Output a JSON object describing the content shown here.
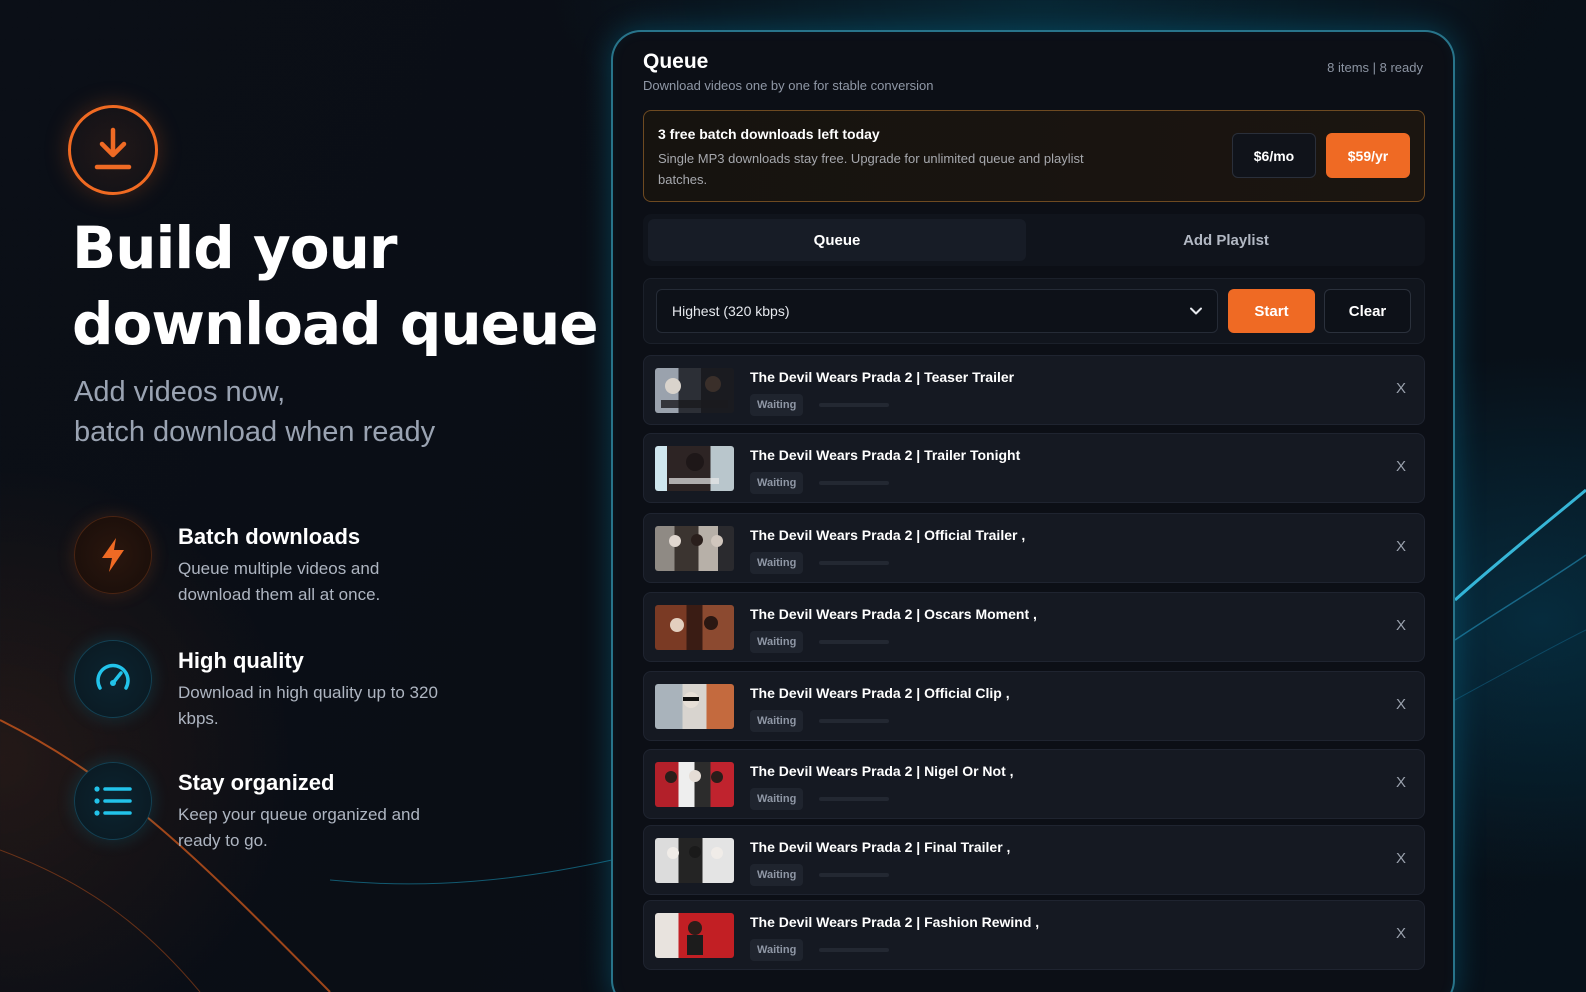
{
  "hero": {
    "title_line1": "Build your",
    "title_line2": "download queue",
    "subtitle_line1": "Add videos now,",
    "subtitle_line2": "batch download when ready",
    "icon": "download-icon",
    "accent": "#ef6a24"
  },
  "features": [
    {
      "icon": "lightning-icon",
      "title": "Batch downloads",
      "desc": "Queue multiple videos and download them all at once."
    },
    {
      "icon": "speedometer-icon",
      "title": "High quality",
      "desc": "Download in high quality up to 320 kbps."
    },
    {
      "icon": "list-icon",
      "title": "Stay organized",
      "desc": "Keep your queue organized and ready to go."
    }
  ],
  "panel": {
    "title": "Queue",
    "subtitle": "Download videos one by one for stable conversion",
    "count": "8 items | 8 ready"
  },
  "promo": {
    "title": "3 free batch downloads left today",
    "text": "Single MP3 downloads stay free. Upgrade for unlimited queue and playlist batches.",
    "monthly_label": "$6/mo",
    "yearly_label": "$59/yr"
  },
  "tabs": [
    {
      "label": "Queue",
      "active": true
    },
    {
      "label": "Add Playlist",
      "active": false
    }
  ],
  "controls": {
    "quality_selected": "Highest (320 kbps)",
    "start_label": "Start",
    "clear_label": "Clear"
  },
  "queue_items": [
    {
      "title": "The Devil Wears Prada 2 | Teaser Trailer",
      "status": "Waiting",
      "progress": 0,
      "remove": "X"
    },
    {
      "title": "The Devil Wears Prada 2 | Trailer Tonight",
      "status": "Waiting",
      "progress": 0,
      "remove": "X"
    },
    {
      "title": "The Devil Wears Prada 2 | Official Trailer ,",
      "status": "Waiting",
      "progress": 0,
      "remove": "X"
    },
    {
      "title": "The Devil Wears Prada 2 | Oscars Moment ,",
      "status": "Waiting",
      "progress": 0,
      "remove": "X"
    },
    {
      "title": "The Devil Wears Prada 2 | Official Clip ,",
      "status": "Waiting",
      "progress": 0,
      "remove": "X"
    },
    {
      "title": "The Devil Wears Prada 2 | Nigel Or Not ,",
      "status": "Waiting",
      "progress": 0,
      "remove": "X"
    },
    {
      "title": "The Devil Wears Prada 2 | Final Trailer ,",
      "status": "Waiting",
      "progress": 0,
      "remove": "X"
    },
    {
      "title": "The Devil Wears Prada 2 | Fashion Rewind ,",
      "status": "Waiting",
      "progress": 0,
      "remove": "X"
    }
  ]
}
